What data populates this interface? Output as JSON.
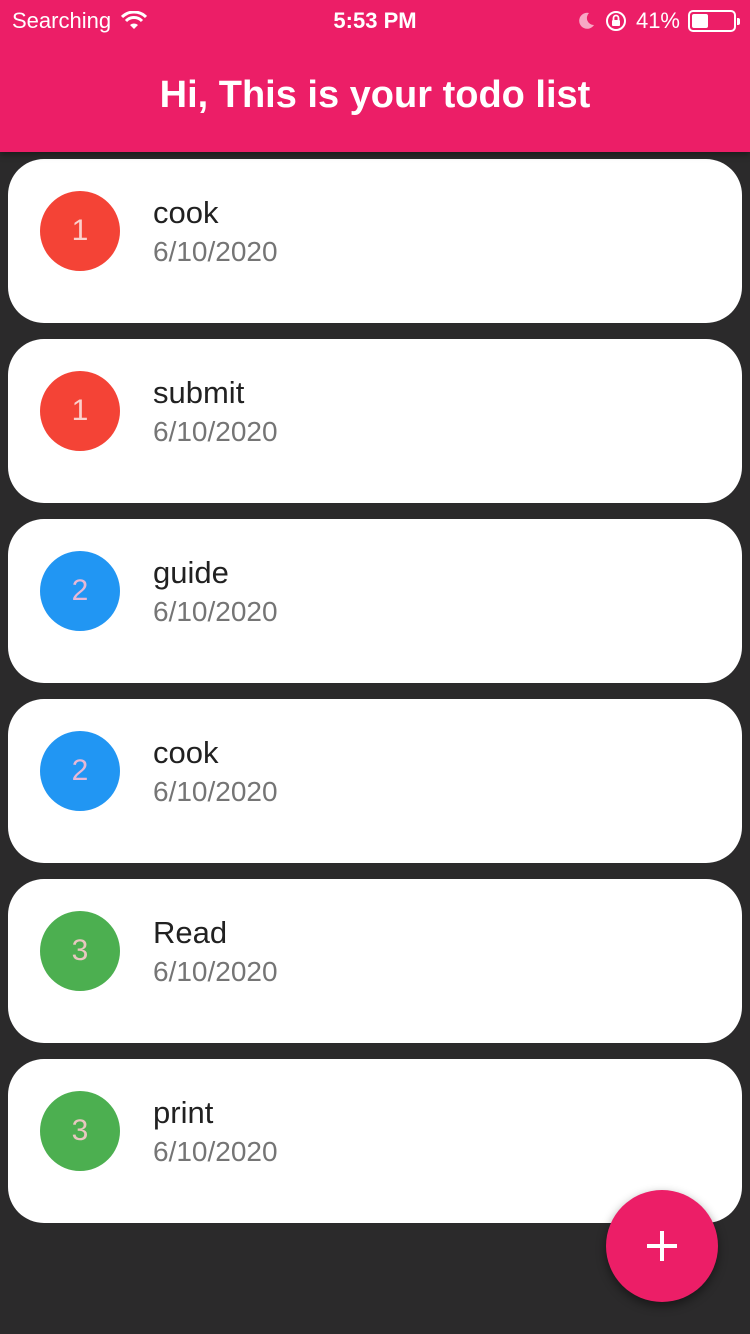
{
  "status_bar": {
    "carrier": "Searching",
    "time": "5:53 PM",
    "battery_percent": "41%",
    "battery_level": 0.41
  },
  "app_bar": {
    "title": "Hi, This is your todo list"
  },
  "todos": [
    {
      "priority": "1",
      "title": "cook",
      "date": "6/10/2020",
      "color": "#f44336",
      "text_color": "#fbd0cc"
    },
    {
      "priority": "1",
      "title": "submit",
      "date": "6/10/2020",
      "color": "#f44336",
      "text_color": "#fbd0cc"
    },
    {
      "priority": "2",
      "title": "guide",
      "date": "6/10/2020",
      "color": "#2196f3",
      "text_color": "#e6b8d6"
    },
    {
      "priority": "2",
      "title": "cook",
      "date": "6/10/2020",
      "color": "#2196f3",
      "text_color": "#e6b8d6"
    },
    {
      "priority": "3",
      "title": "Read",
      "date": "6/10/2020",
      "color": "#4caf50",
      "text_color": "#e8c7c0"
    },
    {
      "priority": "3",
      "title": "print",
      "date": "6/10/2020",
      "color": "#4caf50",
      "text_color": "#e8c7c0"
    }
  ],
  "fab": {
    "icon": "plus-icon",
    "color": "#ec1e67"
  },
  "colors": {
    "accent": "#ec1e67",
    "background": "#2b2a2b"
  }
}
